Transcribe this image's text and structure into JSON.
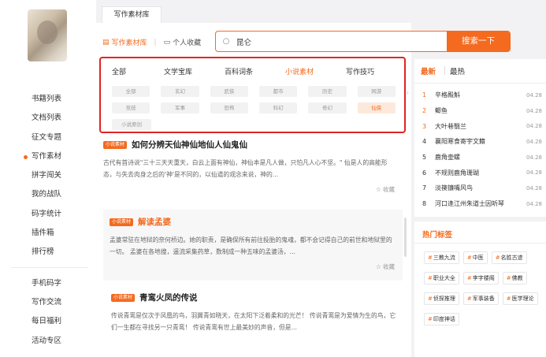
{
  "sidebar": {
    "items_top": [
      "书籍列表",
      "文档列表",
      "征文专题",
      "写作素材",
      "拼字闯关",
      "我的战队",
      "码字统计",
      "插件箱",
      "排行榜"
    ],
    "active_index": 3,
    "items_bottom": [
      "手机码字",
      "写作交流",
      "每日福利",
      "活动专区"
    ]
  },
  "top_tab": "写作素材库",
  "library_tabs": {
    "material": "写作素材库",
    "personal": "个人收藏"
  },
  "search": {
    "value": "昆仑",
    "button": "搜索一下"
  },
  "filter": {
    "categories": [
      "全部",
      "文学宝库",
      "百科词条",
      "小说素材",
      "写作技巧"
    ],
    "active_category": 3,
    "tag_rows": [
      [
        "全部",
        "玄幻",
        "武侠",
        "都市",
        "历史",
        "网游"
      ],
      [
        "竞技",
        "军事",
        "恐怖",
        "科幻",
        "奇幻",
        "仙侠"
      ],
      [
        "小说原创"
      ]
    ],
    "active_tag": "仙侠"
  },
  "articles": [
    {
      "badge": "小说素材",
      "title": "如何分辨天仙神仙地仙人仙鬼仙",
      "body": "古代有首诗说\"三十三天天重天，白云上面有神仙，神仙本是凡人做，只怕凡人心不坚。\"     仙是人的高能形态，与失去肉身之后的'神'是不同的，以仙道的观念来说，神的...",
      "fav": "收藏"
    },
    {
      "badge": "小说素材",
      "title": "解读孟婆",
      "body": "     孟婆常驻在地狱的奈何桥边。她的职责，是确保所有前往投胎的鬼魂，都不会记得自己的前世和地狱里的一切。     孟婆在各地搜，遥流采集药草，数制成一种五味的孟婆汤，...",
      "fav": "收藏"
    },
    {
      "badge": "小说素材",
      "title": "青鸾火凤的传说",
      "body": "传说青鸾是仅次于凤凰的鸟，羽翼青如晓天，在太阳下泛着柔和的光芒！     传说青鸾是为爱情为生的鸟，它们一生都在寻找另一只青鸾！     传说青鸾有世上最美妙的声音，但是..."
    }
  ],
  "ranking": {
    "tabs": [
      "最新",
      "最热"
    ],
    "active_tab": 0,
    "items": [
      {
        "num": "1",
        "title": "辛格殿斛",
        "date": "04.28"
      },
      {
        "num": "2",
        "title": "鲫鱼",
        "date": "04.28"
      },
      {
        "num": "3",
        "title": "大叶巷翳兰",
        "date": "04.28"
      },
      {
        "num": "4",
        "title": "襄阳寒食寄宇文籍",
        "date": "04.28"
      },
      {
        "num": "5",
        "title": "鹿角壶螺",
        "date": "04.28"
      },
      {
        "num": "6",
        "title": "不规则鹿角珊瑚",
        "date": "04.28"
      },
      {
        "num": "7",
        "title": "淡篌镰嘴风鸟",
        "date": "04.28"
      },
      {
        "num": "8",
        "title": "河口逢江州朱道士因听琴",
        "date": "04.28"
      }
    ]
  },
  "hot_tags": {
    "title": "热门标签",
    "tags": [
      "三教九流",
      "中医",
      "名胜古迹",
      "职业大全",
      "李字楼阁",
      "佛教",
      "侦探推理",
      "军事装备",
      "医学理论",
      "印度神话"
    ]
  },
  "colors": {
    "accent": "#f46a1f",
    "highlight_border": "#e02424"
  }
}
